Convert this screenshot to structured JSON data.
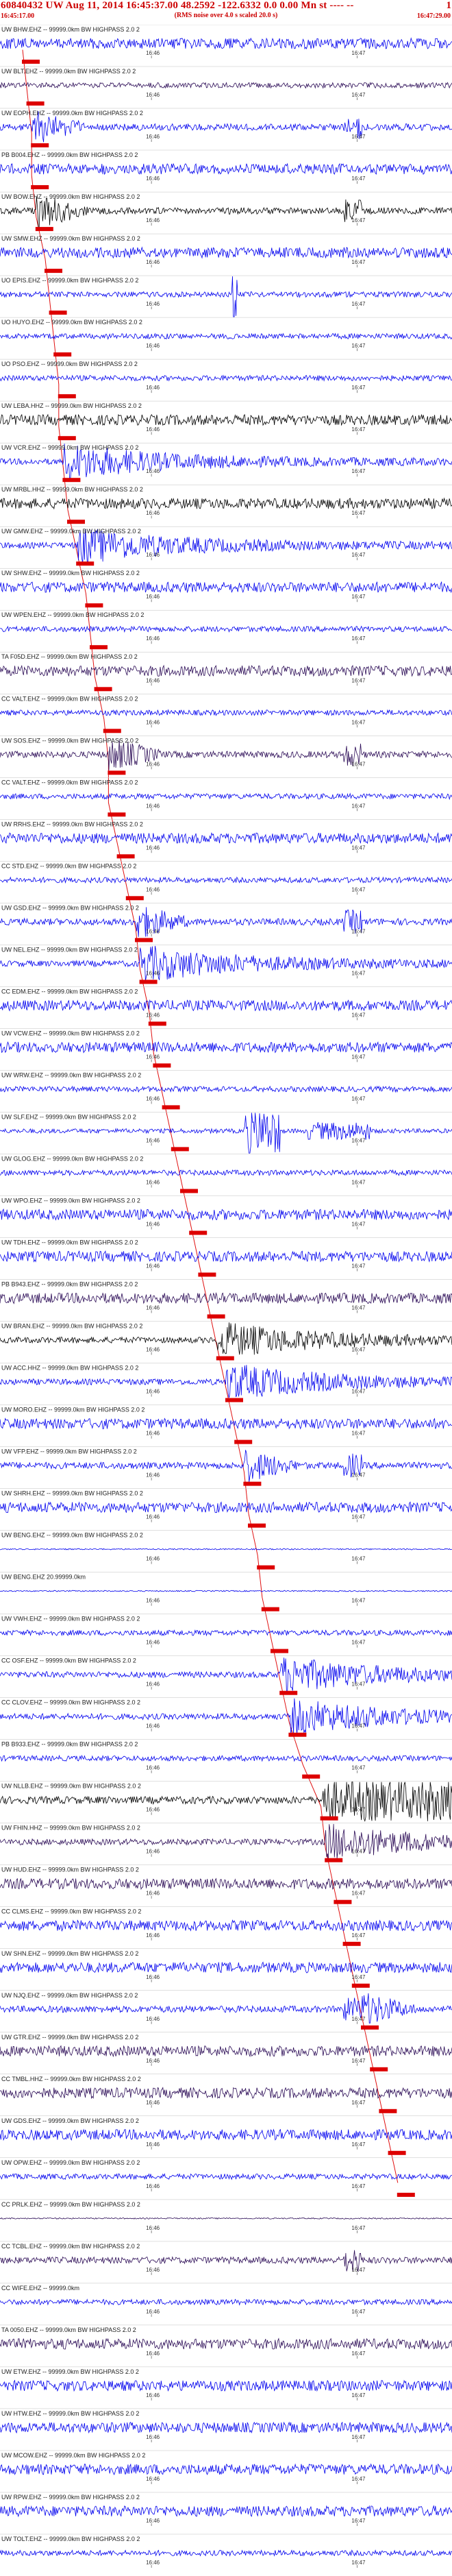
{
  "header": {
    "title": "60840432 UW Aug 11, 2014 16:45:37.00   48.2592  -122.6332   0.0 0.00 Mn st ---- --",
    "right_edge": "1",
    "start_time": "16:45:17.00",
    "note": "(RMS noise over 4.0 s scaled 20.0 s)",
    "end_time": "16:47:29.00"
  },
  "colors": {
    "trace_blue": "#0000ee",
    "trace_black": "#000000",
    "trace_purple": "#2a0a55",
    "label": "#222222",
    "pick": "#dd0000",
    "timeline": "#e01010"
  },
  "chart_data": {
    "type": "line",
    "title": "60840432 UW Aug 11, 2014 16:45:37.00   48.2592  -122.6332   0.0 0.00 Mn st ---- --",
    "x_start": "16:45:17.00",
    "x_end": "16:47:29.00",
    "time_ticks": [
      "16:46",
      "16:47"
    ],
    "channels": [
      {
        "label": "UW BHW.EHZ -- 99999.0km BW  HIGHPASS  2.0  2",
        "color": "blue",
        "pick": 0.05,
        "style": "noisy"
      },
      {
        "label": "UW BLT.EHZ -- 99999.0km BW  HIGHPASS  2.0  2",
        "color": "purple",
        "pick": 0.06,
        "style": "quiet"
      },
      {
        "label": "UW EOPH.EHZ -- 99999.0km BW  HIGHPASS  2.0  2",
        "color": "blue",
        "pick": 0.07,
        "style": "bursty"
      },
      {
        "label": "PB B004.EHZ -- 99999.0km BW  HIGHPASS  2.0  2",
        "color": "blue",
        "pick": 0.07,
        "style": "noisy"
      },
      {
        "label": "UW BOW.EHZ -- 99999.0km BW  HIGHPASS  2.0  2",
        "color": "black",
        "pick": 0.08,
        "style": "bursty"
      },
      {
        "label": "UW SMW.EHZ -- 99999.0km BW  HIGHPASS  2.0  2",
        "color": "blue",
        "pick": 0.1,
        "style": "noisy"
      },
      {
        "label": "UO EPIS.EHZ -- 99999.0km BW  HIGHPASS  2.0  2",
        "color": "blue",
        "pick": 0.11,
        "style": "spike"
      },
      {
        "label": "UO HUYO.EHZ -- 99999.0km BW  HIGHPASS  2.0  2",
        "color": "blue",
        "pick": 0.12,
        "style": "quiet"
      },
      {
        "label": "UO PSO.EHZ -- 99999.0km BW  HIGHPASS  2.0  2",
        "color": "blue",
        "pick": 0.13,
        "style": "quiet"
      },
      {
        "label": "UW LEBA.HHZ -- 99999.0km BW  HIGHPASS  2.0  2",
        "color": "black",
        "pick": 0.13,
        "style": "noisy"
      },
      {
        "label": "UW VCR.EHZ -- 99999.0km BW  HIGHPASS  2.0  2",
        "color": "blue",
        "pick": 0.14,
        "style": "strong"
      },
      {
        "label": "UW MRBL.HHZ -- 99999.0km BW  HIGHPASS  2.0  2",
        "color": "black",
        "pick": 0.15,
        "style": "noisy"
      },
      {
        "label": "UW GMW.EHZ -- 99999.0km BW  HIGHPASS  2.0  2",
        "color": "blue",
        "pick": 0.17,
        "style": "strong"
      },
      {
        "label": "UW SHW.EHZ -- 99999.0km BW  HIGHPASS  2.0  2",
        "color": "blue",
        "pick": 0.19,
        "style": "noisy"
      },
      {
        "label": "UW WPEN.EHZ -- 99999.0km BW  HIGHPASS  2.0  2",
        "color": "blue",
        "pick": 0.2,
        "style": "quiet"
      },
      {
        "label": "TA F05D.EHZ -- 99999.0km BW  HIGHPASS  2.0  2",
        "color": "purple",
        "pick": 0.21,
        "style": "noisy"
      },
      {
        "label": "CC VALT.EHZ -- 99999.0km BW  HIGHPASS  2.0  2",
        "color": "blue",
        "pick": 0.23,
        "style": "quiet"
      },
      {
        "label": "UW SOS.EHZ -- 99999.0km BW  HIGHPASS  2.0  2",
        "color": "purple",
        "pick": 0.24,
        "style": "bursty"
      },
      {
        "label": "CC VALT.EHZ -- 99999.0km BW  HIGHPASS  2.0  2",
        "color": "blue",
        "pick": 0.24,
        "style": "quiet"
      },
      {
        "label": "UW RRHS.EHZ -- 99999.0km BW  HIGHPASS  2.0  2",
        "color": "blue",
        "pick": 0.26,
        "style": "noisy"
      },
      {
        "label": "CC STD.EHZ -- 99999.0km BW  HIGHPASS  2.0  2",
        "color": "blue",
        "pick": 0.28,
        "style": "quiet"
      },
      {
        "label": "UW GSD.EHZ -- 99999.0km BW  HIGHPASS  2.0  2",
        "color": "blue",
        "pick": 0.3,
        "style": "bursty"
      },
      {
        "label": "UW NEL.EHZ -- 99999.0km BW  HIGHPASS  2.0  2",
        "color": "blue",
        "pick": 0.31,
        "style": "strong"
      },
      {
        "label": "CC EDM.EHZ -- 99999.0km BW  HIGHPASS  2.0  2",
        "color": "blue",
        "pick": 0.33,
        "style": "noisy"
      },
      {
        "label": "UW VCW.EHZ -- 99999.0km BW  HIGHPASS  2.0  2",
        "color": "blue",
        "pick": 0.34,
        "style": "noisy"
      },
      {
        "label": "UW WRW.EHZ -- 99999.0km BW  HIGHPASS  2.0  2",
        "color": "blue",
        "pick": 0.36,
        "style": "quiet"
      },
      {
        "label": "UW SLF.EHZ -- 99999.0km BW  HIGHPASS  2.0  2",
        "color": "blue",
        "pick": 0.38,
        "style": "block"
      },
      {
        "label": "UW GLOG.EHZ -- 99999.0km BW  HIGHPASS  2.0  2",
        "color": "blue",
        "pick": 0.4,
        "style": "quiet"
      },
      {
        "label": "UW WPO.EHZ -- 99999.0km BW  HIGHPASS  2.0  2",
        "color": "blue",
        "pick": 0.42,
        "style": "noisy"
      },
      {
        "label": "UW TDH.EHZ -- 99999.0km BW  HIGHPASS  2.0  2",
        "color": "blue",
        "pick": 0.44,
        "style": "noisy"
      },
      {
        "label": "PB B943.EHZ -- 99999.0km BW  HIGHPASS  2.0  2",
        "color": "purple",
        "pick": 0.46,
        "style": "noisy"
      },
      {
        "label": "UW BRAN.EHZ -- 99999.0km BW  HIGHPASS  2.0  2",
        "color": "black",
        "pick": 0.48,
        "style": "strong"
      },
      {
        "label": "UW ACC.HHZ -- 99999.0km BW  HIGHPASS  2.0  2",
        "color": "blue",
        "pick": 0.5,
        "style": "strong"
      },
      {
        "label": "UW MORO.EHZ -- 99999.0km BW  HIGHPASS  2.0  2",
        "color": "blue",
        "pick": 0.52,
        "style": "noisy"
      },
      {
        "label": "UW VFP.EHZ -- 99999.0km BW  HIGHPASS  2.0  2",
        "color": "blue",
        "pick": 0.54,
        "style": "bursty"
      },
      {
        "label": "UW SHRH.EHZ -- 99999.0km BW  HIGHPASS  2.0  2",
        "color": "blue",
        "pick": 0.55,
        "style": "noisy"
      },
      {
        "label": "UW BENG.EHZ -- 99999.0km BW  HIGHPASS  2.0  2",
        "color": "blue",
        "pick": 0.57,
        "style": "flat"
      },
      {
        "label": "UW BENG.EHZ 20.99999.0km",
        "color": "blue",
        "pick": 0.58,
        "style": "flat"
      },
      {
        "label": "UW VWH.EHZ -- 99999.0km BW  HIGHPASS  2.0  2",
        "color": "blue",
        "pick": 0.6,
        "style": "quiet"
      },
      {
        "label": "CC OSF.EHZ -- 99999.0km BW  HIGHPASS  2.0  2",
        "color": "blue",
        "pick": 0.62,
        "style": "strong"
      },
      {
        "label": "CC CLOV.EHZ -- 99999.0km BW  HIGHPASS  2.0  2",
        "color": "blue",
        "pick": 0.64,
        "style": "strong"
      },
      {
        "label": "PB B933.EHZ -- 99999.0km BW  HIGHPASS  2.0  2",
        "color": "blue",
        "pick": 0.67,
        "style": "quiet"
      },
      {
        "label": "UW NLLB.EHZ -- 99999.0km BW  HIGHPASS  2.0  2",
        "color": "black",
        "pick": 0.71,
        "style": "saturated"
      },
      {
        "label": "UW FHIN.HHZ -- 99999.0km BW  HIGHPASS  2.0  2",
        "color": "purple",
        "pick": 0.72,
        "style": "strong"
      },
      {
        "label": "UW HUD.EHZ -- 99999.0km BW  HIGHPASS  2.0  2",
        "color": "purple",
        "pick": 0.74,
        "style": "noisy"
      },
      {
        "label": "CC CLMS.EHZ -- 99999.0km BW  HIGHPASS  2.0  2",
        "color": "blue",
        "pick": 0.76,
        "style": "noisy"
      },
      {
        "label": "UW SHN.EHZ -- 99999.0km BW  HIGHPASS  2.0  2",
        "color": "blue",
        "pick": 0.78,
        "style": "noisy"
      },
      {
        "label": "UW NJQ.EHZ -- 99999.0km BW  HIGHPASS  2.0  2",
        "color": "blue",
        "pick": 0.8,
        "style": "bursty"
      },
      {
        "label": "UW GTR.EHZ -- 99999.0km BW  HIGHPASS  2.0  2",
        "color": "purple",
        "pick": 0.82,
        "style": "noisy"
      },
      {
        "label": "CC TMBL.HHZ -- 99999.0km BW  HIGHPASS  2.0  2",
        "color": "purple",
        "pick": 0.84,
        "style": "noisy"
      },
      {
        "label": "UW GDS.EHZ -- 99999.0km BW  HIGHPASS  2.0  2",
        "color": "blue",
        "pick": 0.86,
        "style": "noisy"
      },
      {
        "label": "UW OPW.EHZ -- 99999.0km BW  HIGHPASS  2.0  2",
        "color": "blue",
        "pick": 0.88,
        "style": "quiet"
      },
      {
        "label": "CC PRLK.EHZ -- 99999.0km BW  HIGHPASS  2.0  2",
        "color": "purple",
        "pick": null,
        "style": "flat"
      },
      {
        "label": "CC TCBL.EHZ -- 99999.0km BW  HIGHPASS  2.0  2",
        "color": "purple",
        "pick": null,
        "style": "bursty"
      },
      {
        "label": "CC WIFE.EHZ -- 99999.0km",
        "color": "blue",
        "pick": null,
        "style": "quiet"
      },
      {
        "label": "TA 0050.EHZ -- 99999.0km BW  HIGHPASS  2.0  2",
        "color": "purple",
        "pick": null,
        "style": "noisy"
      },
      {
        "label": "UW ETW.EHZ -- 99999.0km BW  HIGHPASS  2.0  2",
        "color": "blue",
        "pick": null,
        "style": "noisy"
      },
      {
        "label": "UW HTW.EHZ -- 99999.0km BW  HIGHPASS  2.0  2",
        "color": "blue",
        "pick": null,
        "style": "noisy"
      },
      {
        "label": "UW MCOW.EHZ -- 99999.0km BW  HIGHPASS  2.0  2",
        "color": "blue",
        "pick": null,
        "style": "noisy"
      },
      {
        "label": "UW RPW.EHZ -- 99999.0km BW  HIGHPASS  2.0  2",
        "color": "blue",
        "pick": null,
        "style": "noisy"
      },
      {
        "label": "UW TOLT.EHZ -- 99999.0km BW  HIGHPASS  2.0  2",
        "color": "blue",
        "pick": null,
        "style": "quiet"
      }
    ]
  }
}
